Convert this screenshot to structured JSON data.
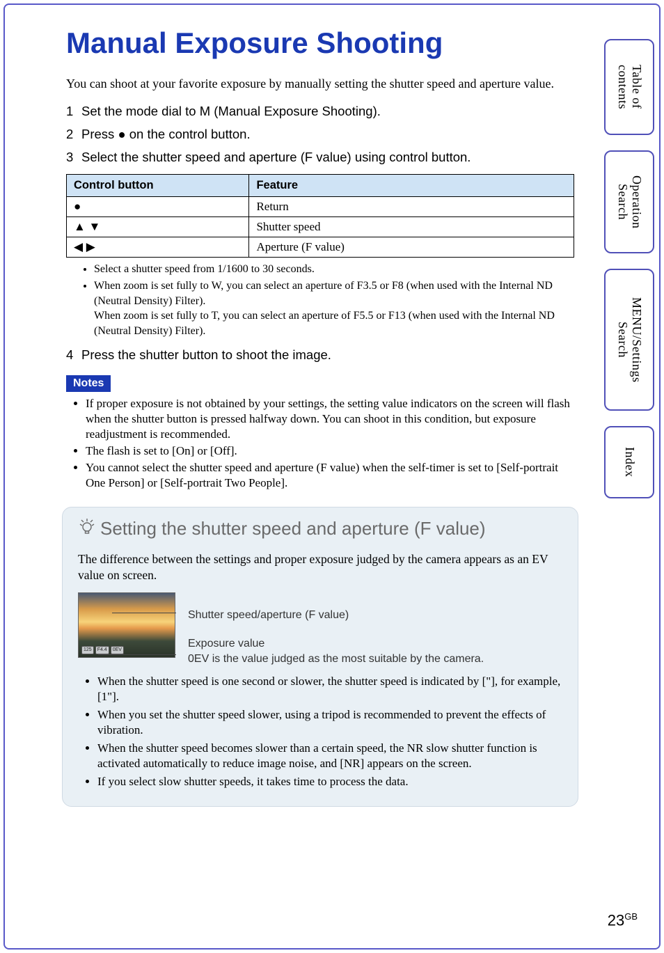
{
  "title": "Manual Exposure Shooting",
  "intro": "You can shoot at your favorite exposure by manually setting the shutter speed and aperture value.",
  "steps": {
    "s1_num": "1",
    "s1_a": "Set the mode dial to ",
    "s1_sym": "M",
    "s1_b": " (Manual Exposure Shooting).",
    "s2_num": "2",
    "s2_a": "Press ",
    "s2_sym": "●",
    "s2_b": " on the control button.",
    "s3_num": "3",
    "s3": "Select the shutter speed and aperture (F value) using control button.",
    "s4_num": "4",
    "s4": "Press the shutter button to shoot the image."
  },
  "table": {
    "h1": "Control button",
    "h2": "Feature",
    "rows": [
      {
        "sym": "●",
        "feat": "Return"
      },
      {
        "sym": "▲ ▼",
        "feat": "Shutter speed"
      },
      {
        "sym": "◀ ▶",
        "feat": "Aperture (F value)"
      }
    ]
  },
  "step3_bullets": {
    "b1": "Select a shutter speed from 1/1600 to 30 seconds.",
    "b2a": "When zoom is set fully to W, you can select an aperture of F3.5 or F8 (when used with the Internal ND (Neutral Density) Filter).",
    "b2b": "When zoom is set fully to T, you can select an aperture of F5.5 or F13 (when used with the Internal ND (Neutral Density) Filter)."
  },
  "notes_label": "Notes",
  "notes": {
    "n1": "If proper exposure is not obtained by your settings, the setting value indicators on the screen will flash when the shutter button is pressed halfway down. You can shoot in this condition, but exposure readjustment is recommended.",
    "n2": "The flash is set to [On] or [Off].",
    "n3": "You cannot select the shutter speed and aperture (F value) when the self-timer is set to [Self-portrait One Person] or [Self-portrait Two People]."
  },
  "tip": {
    "heading": "Setting the shutter speed and aperture (F value)",
    "intro": "The difference between the settings and proper exposure judged by the camera appears as an EV value on screen.",
    "thumb": {
      "chip1": "125",
      "chip2": "F4.4",
      "chip3": "0EV"
    },
    "callout1": "Shutter speed/aperture (F value)",
    "callout2a": "Exposure value",
    "callout2b": "0EV is the value judged as the most suitable by the camera.",
    "list": {
      "t1": "When the shutter speed is one second or slower, the shutter speed is indicated by [\"], for example, [1\"].",
      "t2": "When you set the shutter speed slower, using a tripod is recommended to prevent the effects of vibration.",
      "t3": "When the shutter speed becomes slower than a certain speed, the NR slow shutter function is activated automatically to reduce image noise, and [NR] appears on the screen.",
      "t4": "If you select slow shutter speeds, it takes time to process the data."
    }
  },
  "tabs": {
    "t1a": "Table of",
    "t1b": "contents",
    "t2a": "Operation",
    "t2b": "Search",
    "t3a": "MENU/Settings",
    "t3b": "Search",
    "t4": "Index"
  },
  "page": {
    "num": "23",
    "suffix": "GB"
  }
}
